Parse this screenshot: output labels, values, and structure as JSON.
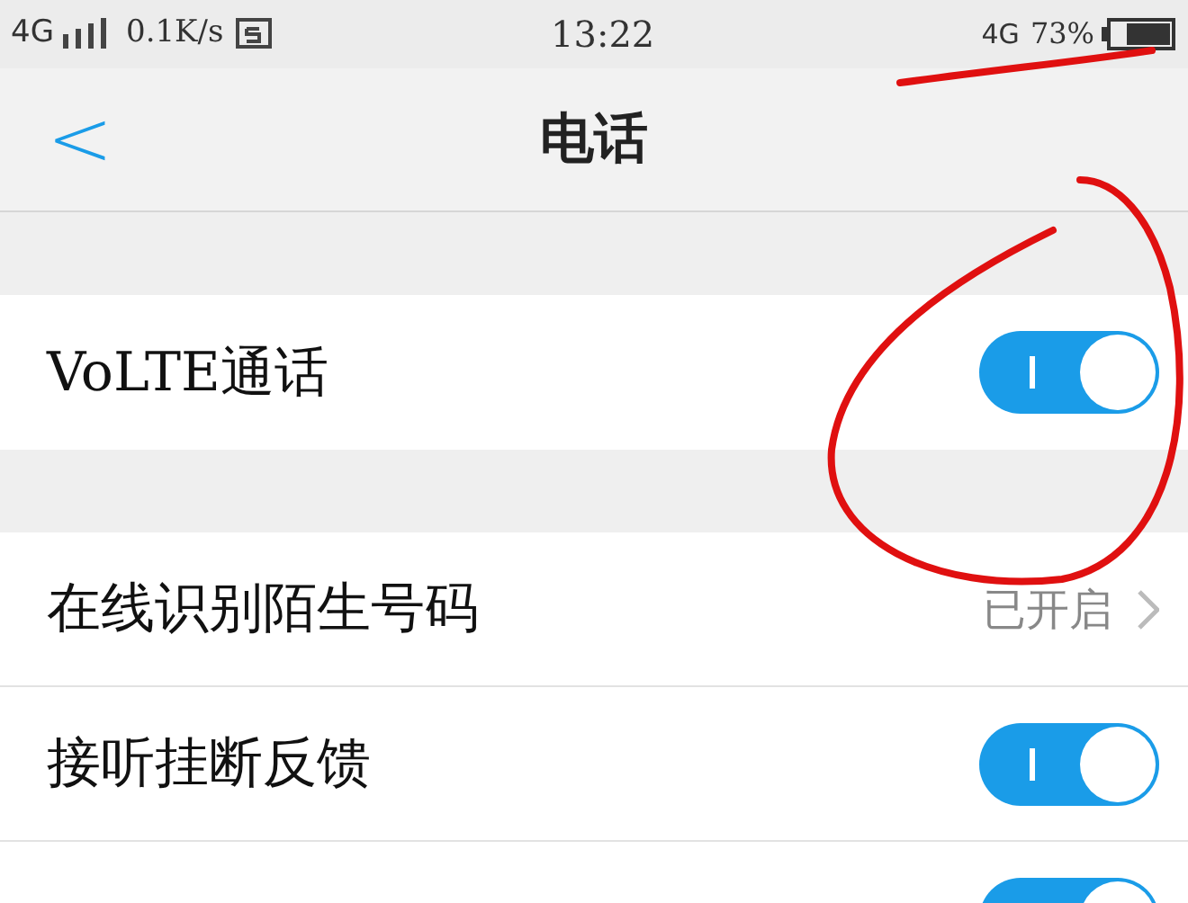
{
  "status_bar": {
    "network": "4G",
    "speed": "0.1K/s",
    "time": "13:22",
    "network_right": "4G",
    "battery": "73%"
  },
  "header": {
    "back": "<",
    "title": "电话"
  },
  "sections": [
    {
      "rows": [
        {
          "kind": "toggle",
          "label": "VoLTE通话",
          "on": true
        }
      ]
    },
    {
      "rows": [
        {
          "kind": "link",
          "label": "在线识别陌生号码",
          "value": "已开启"
        },
        {
          "kind": "toggle",
          "label": "接听挂断反馈",
          "on": true
        },
        {
          "kind": "toggle",
          "on": true
        }
      ]
    }
  ],
  "annotations": {
    "underline": true,
    "circle": true
  }
}
